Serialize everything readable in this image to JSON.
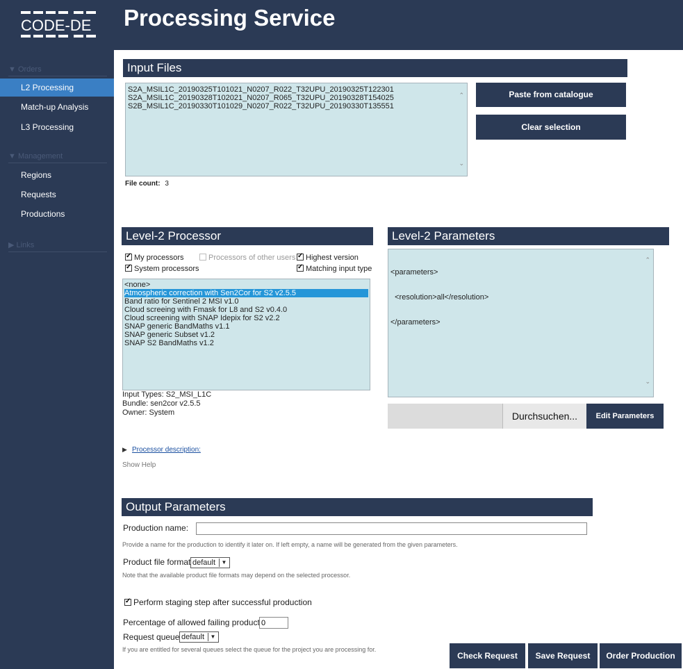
{
  "header": {
    "title": "Processing Service",
    "logo_text": "CODE-DE"
  },
  "sidebar": {
    "sections": [
      {
        "label": "Orders",
        "items": [
          "L2 Processing",
          "Match-up Analysis",
          "L3 Processing"
        ]
      },
      {
        "label": "Management",
        "items": [
          "Regions",
          "Requests",
          "Productions"
        ]
      },
      {
        "label": "Links",
        "items": []
      }
    ],
    "active_item": "L2 Processing"
  },
  "input_files": {
    "heading": "Input Files",
    "files": [
      "S2A_MSIL1C_20190325T101021_N0207_R022_T32UPU_20190325T122301",
      "S2A_MSIL1C_20190328T102021_N0207_R065_T32UPU_20190328T154025",
      "S2B_MSIL1C_20190330T101029_N0207_R022_T32UPU_20190330T135551"
    ],
    "file_count_label": "File count:",
    "file_count": "3",
    "paste_button": "Paste from catalogue",
    "clear_button": "Clear selection"
  },
  "processor": {
    "heading": "Level-2 Processor",
    "checkboxes": {
      "my_processors": {
        "label": "My processors",
        "checked": true
      },
      "other_users": {
        "label": "Processors of other users",
        "checked": false
      },
      "highest_version": {
        "label": "Highest version",
        "checked": true
      },
      "system_processors": {
        "label": "System processors",
        "checked": true
      },
      "matching_input": {
        "label": "Matching input type",
        "checked": true
      }
    },
    "items": [
      "<none>",
      "Atmospheric correction with Sen2Cor for S2 v2.5.5",
      "Band ratio for Sentinel 2 MSI v1.0",
      "Cloud screeing with Fmask for L8 and S2 v0.4.0",
      "Cloud screening with SNAP Idepix for S2 v2.2",
      "SNAP generic BandMaths v1.1",
      "SNAP generic Subset v1.2",
      "SNAP S2 BandMaths v1.2"
    ],
    "selected_index": 1,
    "info": {
      "input_types": "Input Types: S2_MSI_L1C",
      "bundle": "Bundle: sen2cor v2.5.5",
      "owner": "Owner: System"
    },
    "description_link": "Processor description:",
    "show_help": "Show Help"
  },
  "parameters": {
    "heading": "Level-2 Parameters",
    "lines": [
      "<parameters>",
      "  <resolution>all</resolution>",
      "</parameters>"
    ],
    "browse_button": "Durchsuchen...",
    "edit_button": "Edit Parameters"
  },
  "output": {
    "heading": "Output Parameters",
    "production_name_label": "Production name:",
    "production_name_value": "",
    "production_name_hint": "Provide a name for the production to identify it later on. If left empty, a name will be generated from the given parameters.",
    "file_format_label": "Product file format:",
    "file_format_value": "default",
    "file_format_hint": "Note that the available product file formats may depend on the selected processor.",
    "staging_label": "Perform staging step after successful production",
    "staging_checked": true,
    "failing_label": "Percentage of allowed failing products:",
    "failing_value": "0",
    "queue_label": "Request queue:",
    "queue_value": "default",
    "queue_hint": "If you are entitled for several queues select the queue for the project you are processing for."
  },
  "actions": {
    "check": "Check Request",
    "save": "Save Request",
    "order": "Order Production"
  },
  "colors": {
    "navy": "#2b3a55",
    "active": "#3a7fc4",
    "listbox": "#cfe6ea",
    "selection": "#2596d8"
  }
}
